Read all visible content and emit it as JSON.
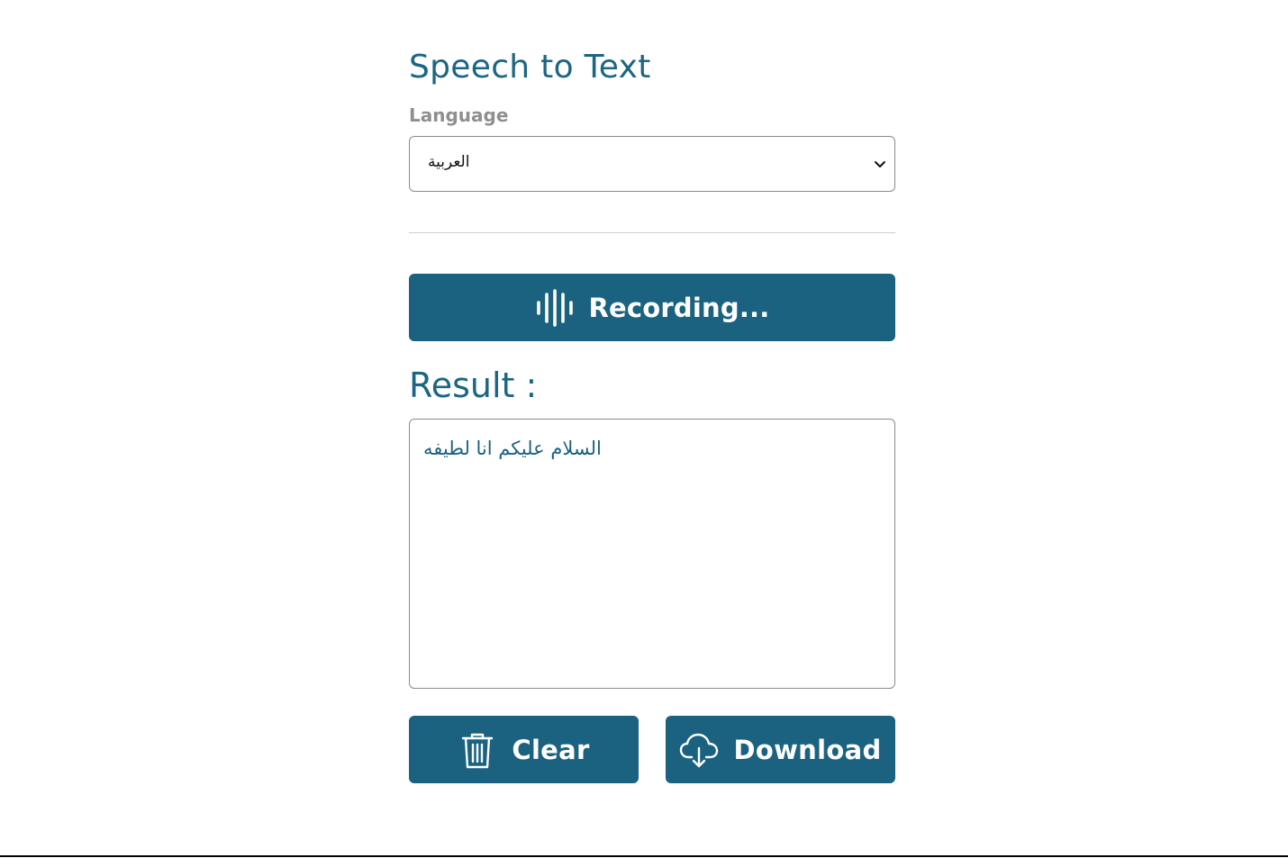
{
  "header": {
    "title": "Speech to Text"
  },
  "language": {
    "label": "Language",
    "selected": "العربية"
  },
  "recorder": {
    "button_label": "Recording...",
    "icon": "sound-wave-icon"
  },
  "result": {
    "title": "Result :",
    "text": "السلام عليكم انا لطيفه"
  },
  "actions": {
    "clear_label": "Clear",
    "clear_icon": "trash-icon",
    "download_label": "Download",
    "download_icon": "cloud-download-icon"
  },
  "colors": {
    "primary": "#1b6280",
    "title": "#1b6682",
    "label_gray": "#8f8f8f"
  }
}
